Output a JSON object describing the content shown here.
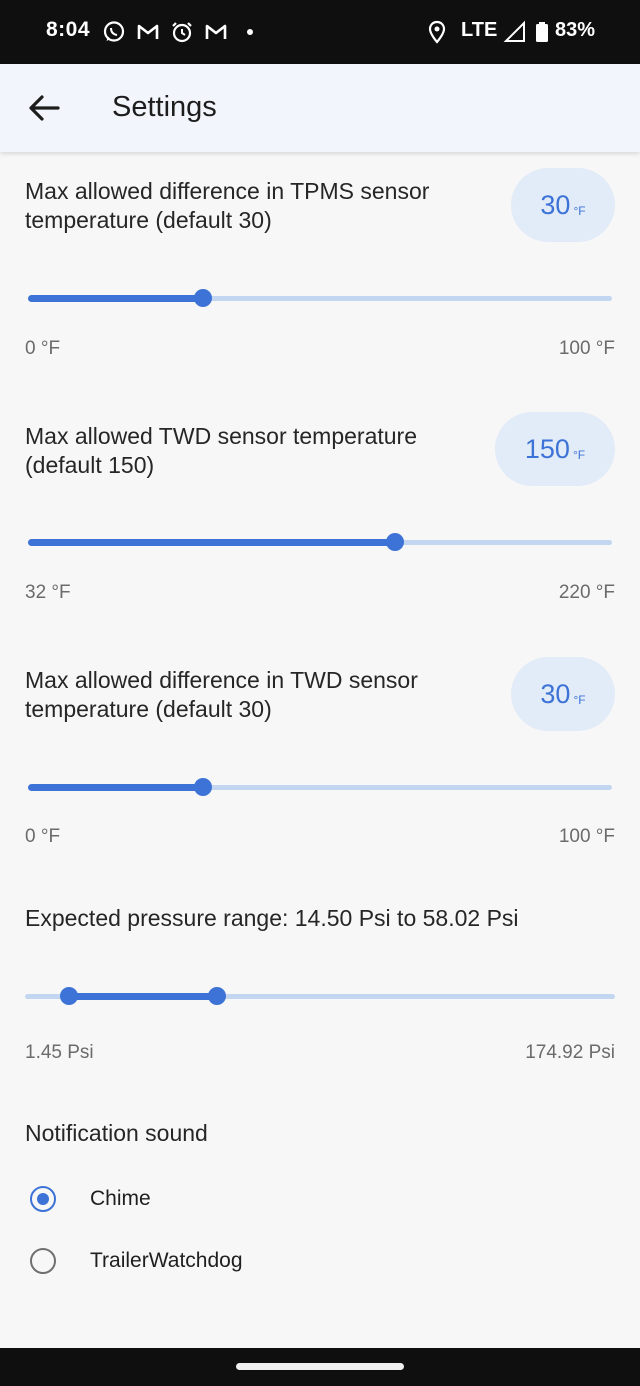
{
  "status_bar": {
    "time": "8:04",
    "network": "LTE",
    "battery": "83%",
    "icons": [
      "whatsapp-icon",
      "gmail-icon",
      "alarm-icon",
      "gmail-icon",
      "location-icon",
      "signal-icon",
      "battery-icon"
    ]
  },
  "app_bar": {
    "title": "Settings",
    "back_icon": "arrow-back-icon"
  },
  "settings": {
    "tpms_diff": {
      "label": "Max allowed difference in TPMS sensor temperature (default 30)",
      "value": "30",
      "unit": "°F",
      "min_label": "0 °F",
      "max_label": "100 °F",
      "min": 0,
      "max": 100,
      "current": 30
    },
    "twd_max": {
      "label": "Max allowed TWD sensor temperature (default 150)",
      "value": "150",
      "unit": "°F",
      "min_label": "32 °F",
      "max_label": "220 °F",
      "min": 32,
      "max": 220,
      "current": 150
    },
    "twd_diff": {
      "label": "Max allowed difference in TWD sensor temperature (default 30)",
      "value": "30",
      "unit": "°F",
      "min_label": "0 °F",
      "max_label": "100 °F",
      "min": 0,
      "max": 100,
      "current": 30
    },
    "pressure": {
      "label": "Expected pressure range: 14.50 Psi to 58.02 Psi",
      "min_label": "1.45 Psi",
      "max_label": "174.92 Psi",
      "min": 1.45,
      "max": 174.92,
      "low": 14.5,
      "high": 58.02
    }
  },
  "notification": {
    "title": "Notification sound",
    "options": [
      {
        "label": "Chime",
        "selected": true
      },
      {
        "label": "TrailerWatchdog",
        "selected": false
      }
    ]
  },
  "colors": {
    "accent": "#3d73d6",
    "track": "#c3d6f1",
    "pill": "#e2ebf8"
  }
}
